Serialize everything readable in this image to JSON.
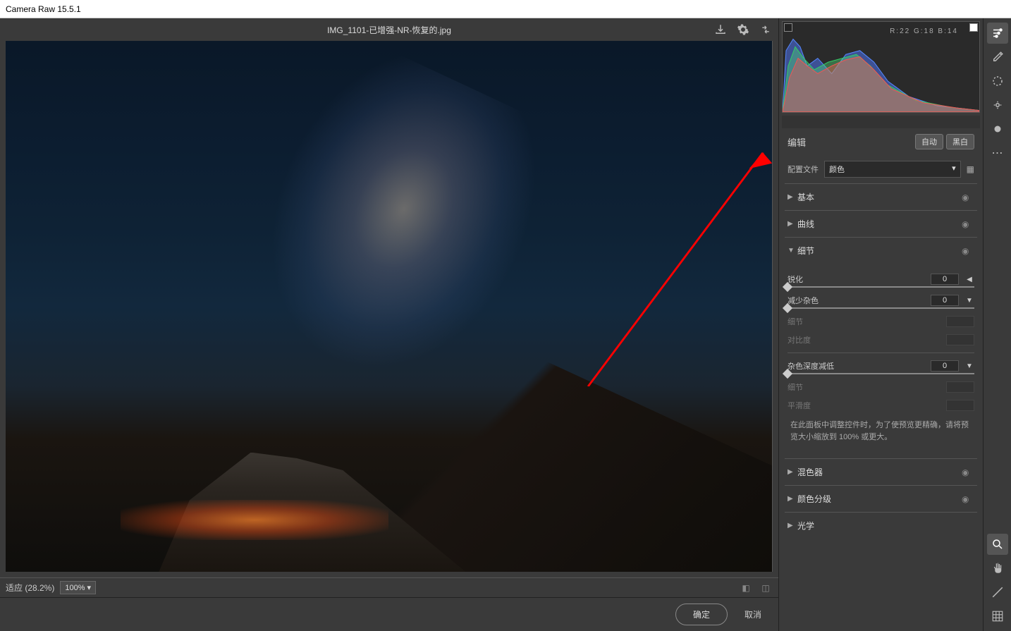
{
  "app_title": "Camera Raw 15.5.1",
  "filename": "IMG_1101-已增强-NR-恢复的.jpg",
  "histogram_readout": "R:22   G:18   B:14",
  "edit_section": {
    "title": "编辑",
    "auto_btn": "自动",
    "bw_btn": "黑白"
  },
  "profile": {
    "label": "配置文件",
    "value": "颜色"
  },
  "sections": {
    "basic": "基本",
    "curve": "曲线",
    "detail": "细节",
    "mixer": "混色器",
    "grading": "颜色分级",
    "optics": "光学"
  },
  "detail": {
    "sharpen": {
      "label": "锐化",
      "value": "0"
    },
    "noise_reduce": {
      "label": "减少杂色",
      "value": "0"
    },
    "nr_detail": {
      "label": "细节",
      "value": ""
    },
    "nr_contrast": {
      "label": "对比度",
      "value": ""
    },
    "color_nr": {
      "label": "杂色深度减低",
      "value": "0"
    },
    "cnr_detail": {
      "label": "细节",
      "value": ""
    },
    "cnr_smooth": {
      "label": "平滑度",
      "value": ""
    },
    "hint": "在此面板中调整控件时，为了使预览更精确，请将预览大小缩放到 100% 或更大。"
  },
  "footer": {
    "fit": "适应 (28.2%)",
    "zoom": "100%"
  },
  "actions": {
    "ok": "确定",
    "cancel": "取消"
  }
}
